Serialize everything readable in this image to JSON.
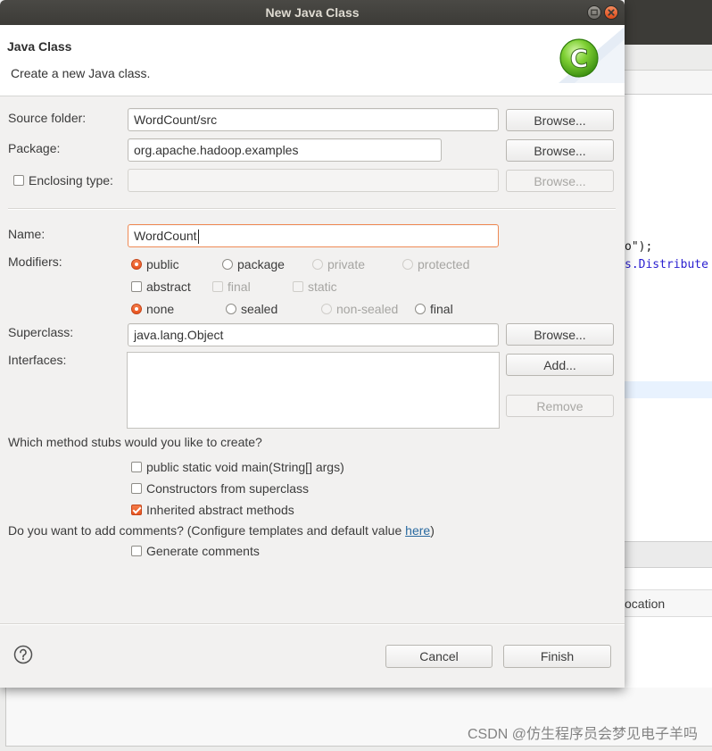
{
  "window": {
    "title": "New Java Class"
  },
  "header": {
    "title": "Java Class",
    "description": "Create a new Java class.",
    "icon": "java-class-wizard-icon",
    "icon_letter": "C"
  },
  "form": {
    "source_folder": {
      "label": "Source folder:",
      "value": "WordCount/src",
      "browse_label": "Browse..."
    },
    "package": {
      "label": "Package:",
      "value": "org.apache.hadoop.examples",
      "browse_label": "Browse..."
    },
    "enclosing_type": {
      "label": "Enclosing type:",
      "checked": false,
      "disabled": true,
      "browse_label": "Browse..."
    },
    "name": {
      "label": "Name:",
      "value": "WordCount",
      "focused": true
    },
    "modifiers": {
      "label": "Modifiers:",
      "access": [
        {
          "label": "public",
          "checked": true,
          "disabled": false
        },
        {
          "label": "package",
          "checked": false,
          "disabled": false
        },
        {
          "label": "private",
          "checked": false,
          "disabled": true
        },
        {
          "label": "protected",
          "checked": false,
          "disabled": true
        }
      ],
      "flags": [
        {
          "label": "abstract",
          "checked": false,
          "disabled": false
        },
        {
          "label": "final",
          "checked": false,
          "disabled": true
        },
        {
          "label": "static",
          "checked": false,
          "disabled": true
        }
      ],
      "sealing": [
        {
          "label": "none",
          "checked": true,
          "disabled": false
        },
        {
          "label": "sealed",
          "checked": false,
          "disabled": false
        },
        {
          "label": "non-sealed",
          "checked": false,
          "disabled": true
        },
        {
          "label": "final",
          "checked": false,
          "disabled": false
        }
      ]
    },
    "superclass": {
      "label": "Superclass:",
      "value": "java.lang.Object",
      "browse_label": "Browse..."
    },
    "interfaces": {
      "label": "Interfaces:",
      "items": [],
      "add_label": "Add...",
      "remove_label": "Remove",
      "remove_disabled": true
    }
  },
  "stubs": {
    "question": "Which method stubs would you like to create?",
    "options": [
      {
        "label": "public static void main(String[] args)",
        "checked": false
      },
      {
        "label": "Constructors from superclass",
        "checked": false
      },
      {
        "label": "Inherited abstract methods",
        "checked": true
      }
    ]
  },
  "comments": {
    "question_before": "Do you want to add comments? (Configure templates and default value ",
    "link": "here",
    "question_after": ")",
    "generate": {
      "label": "Generate comments",
      "checked": false
    }
  },
  "footer": {
    "help_icon": "help-icon",
    "cancel_label": "Cancel",
    "finish_label": "Finish"
  },
  "background": {
    "code_fragments": [
      "o\");",
      "s.Distribute"
    ],
    "panel_header_fragment": "ocation"
  },
  "watermark": "CSDN @仿生程序员会梦见电子羊吗",
  "colors": {
    "titlebar": "#3c3b37",
    "accent": "#e95420",
    "dialog_background": "#f2f1f0",
    "link": "#2a6aa0",
    "focus_border": "#ef8a55"
  }
}
